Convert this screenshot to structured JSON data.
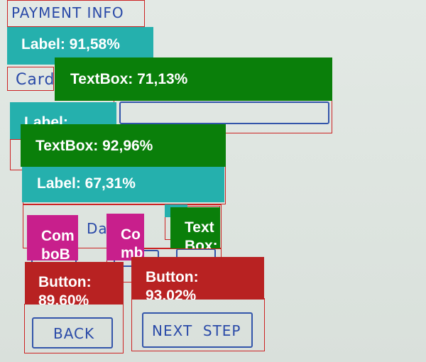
{
  "sketch": {
    "title": "PAYMENT   INFO",
    "card_label": "Card",
    "date_label": "Da",
    "back_button": "BACK",
    "next_button": "NEXT  STEP"
  },
  "detections": {
    "label_1": "Label: 91,58%",
    "textbox_1": "TextBox: 71,13%",
    "label_2": "Label:",
    "textbox_2": "TextBox: 92,96%",
    "label_3": "Label: 67,31%",
    "combobox_1": "Com\nboB",
    "combobox_2": "Co\nmb",
    "textbox_3": "Text\nBox:",
    "button_1": "Button:\n89,60%",
    "button_2": "Button:\n93,02%"
  },
  "colors": {
    "label": "#25b0ad",
    "textbox": "#0a7f0a",
    "combobox": "#c81f8c",
    "button": "#b82222",
    "sketch_ink": "#2a4aa8"
  }
}
